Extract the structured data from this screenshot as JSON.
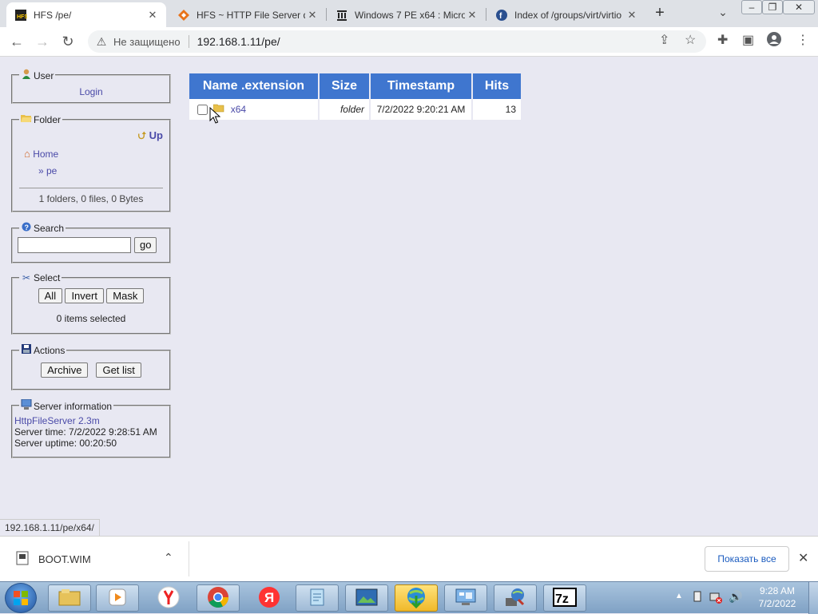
{
  "browser": {
    "tabs": [
      {
        "title": "HFS /pe/",
        "active": true,
        "icon": "hfs-icon"
      },
      {
        "title": "HFS ~ HTTP File Server do",
        "active": false,
        "icon": "hfs-diamond-icon"
      },
      {
        "title": "Windows 7 PE x64 : Micro",
        "active": false,
        "icon": "archive-org-icon"
      },
      {
        "title": "Index of /groups/virt/virtio",
        "active": false,
        "icon": "fedora-icon"
      }
    ],
    "not_secure_label": "Не защищено",
    "url": "192.168.1.11/pe/"
  },
  "sidebar": {
    "user": {
      "legend": "User",
      "login": "Login"
    },
    "folder": {
      "legend": "Folder",
      "up": "Up",
      "home": "Home",
      "crumb": "» pe",
      "summary": "1 folders, 0 files, 0 Bytes"
    },
    "search": {
      "legend": "Search",
      "go": "go",
      "value": ""
    },
    "select": {
      "legend": "Select",
      "all": "All",
      "invert": "Invert",
      "mask": "Mask",
      "status": "0 items selected"
    },
    "actions": {
      "legend": "Actions",
      "archive": "Archive",
      "get_list": "Get list"
    },
    "server": {
      "legend": "Server information",
      "link": "HttpFileServer 2.3m",
      "time": "Server time: 7/2/2022 9:28:51 AM",
      "uptime": "Server uptime: 00:20:50"
    }
  },
  "file_table": {
    "headers": {
      "name": "Name .extension",
      "size": "Size",
      "timestamp": "Timestamp",
      "hits": "Hits"
    },
    "rows": [
      {
        "name": "x64",
        "size": "folder",
        "timestamp": "7/2/2022 9:20:21 AM",
        "hits": "13"
      }
    ]
  },
  "status_url": "192.168.1.11/pe/x64/",
  "download_bar": {
    "file": "BOOT.WIM",
    "show_all": "Показать все"
  },
  "taskbar": {
    "time": "9:28 AM",
    "date": "7/2/2022"
  },
  "colors": {
    "header_blue": "#3f76cf",
    "link": "#4a4aa8",
    "page_bg": "#e8e8f2"
  }
}
